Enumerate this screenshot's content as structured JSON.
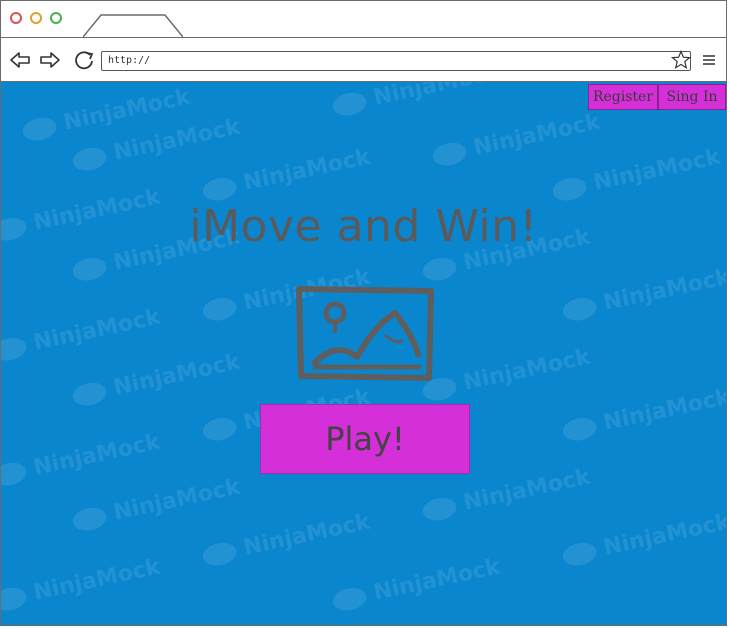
{
  "browser": {
    "url": "http://",
    "colors": {
      "close": "#d9534f",
      "minimize": "#e0a030",
      "maximize": "#4cae4c"
    }
  },
  "watermark": {
    "text": "NinjaMock"
  },
  "header": {
    "register_label": "Register",
    "signin_label": "Sing In"
  },
  "main": {
    "headline": "iMove and Win!",
    "image_icon": "image-placeholder-icon",
    "play_label": "Play!"
  },
  "colors": {
    "background": "#0a86cf",
    "accent": "#d42fd8",
    "text": "#5a5a5a"
  }
}
